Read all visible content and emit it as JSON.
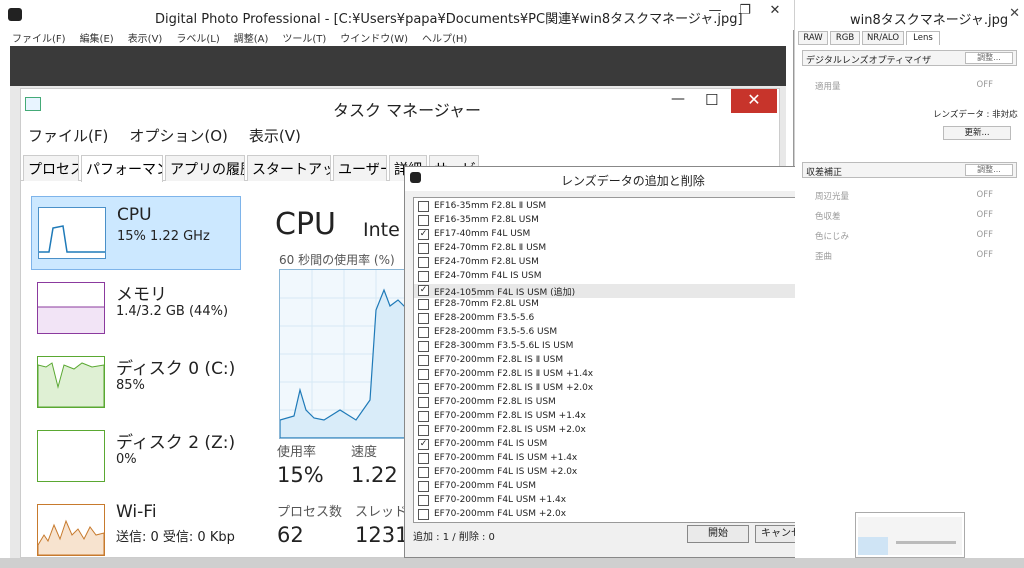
{
  "dpp": {
    "title": "Digital Photo Professional - [C:¥Users¥papa¥Documents¥PC関連¥win8タスクマネージャ.jpg]",
    "menu": [
      "ファイル(F)",
      "編集(E)",
      "表示(V)",
      "ラベル(L)",
      "調整(A)",
      "ツール(T)",
      "ウインドウ(W)",
      "ヘルプ(H)"
    ],
    "btn_min": "—",
    "btn_max": "❐",
    "btn_close": "✕"
  },
  "taskmgr": {
    "title": "タスク マネージャー",
    "btn_min": "—",
    "btn_max": "☐",
    "btn_close": "✕",
    "menu": [
      "ファイル(F)",
      "オプション(O)",
      "表示(V)"
    ],
    "tabs": [
      "プロセス",
      "パフォーマンス",
      "アプリの履歴",
      "スタートアップ",
      "ユーザー",
      "詳細",
      "サービス"
    ],
    "sidebar": [
      {
        "name": "CPU",
        "value": "15% 1.22 GHz"
      },
      {
        "name": "メモリ",
        "value": "1.4/3.2 GB (44%)"
      },
      {
        "name": "ディスク 0 (C:)",
        "value": "85%"
      },
      {
        "name": "ディスク 2 (Z:)",
        "value": "0%"
      },
      {
        "name": "Wi-Fi",
        "value": "送信: 0 受信: 0 Kbp"
      }
    ],
    "cpu": {
      "heading": "CPU",
      "model": "Inte",
      "graph_label": "60 秒間の使用率 (%)",
      "usage_label": "使用率",
      "usage": "15%",
      "speed_label": "速度",
      "speed": "1.22",
      "proc_label": "プロセス数",
      "proc": "62",
      "thread_label": "スレッド数",
      "thread": "1231"
    }
  },
  "lensdlg": {
    "title": "レンズデータの追加と削除",
    "btn_close": "✕",
    "lenses": [
      {
        "label": "EF16-35mm F2.8L Ⅱ USM",
        "checked": false
      },
      {
        "label": "EF16-35mm F2.8L USM",
        "checked": false
      },
      {
        "label": "EF17-40mm F4L USM",
        "checked": true
      },
      {
        "label": "EF24-70mm F2.8L Ⅱ USM",
        "checked": false
      },
      {
        "label": "EF24-70mm F2.8L USM",
        "checked": false
      },
      {
        "label": "EF24-70mm F4L IS USM",
        "checked": false
      },
      {
        "label": "EF24-105mm F4L IS USM (追加)",
        "checked": true
      },
      {
        "label": "EF28-70mm F2.8L USM",
        "checked": false
      },
      {
        "label": "EF28-200mm F3.5-5.6",
        "checked": false
      },
      {
        "label": "EF28-200mm F3.5-5.6 USM",
        "checked": false
      },
      {
        "label": "EF28-300mm F3.5-5.6L IS USM",
        "checked": false
      },
      {
        "label": "EF70-200mm F2.8L IS Ⅱ USM",
        "checked": false
      },
      {
        "label": "EF70-200mm F2.8L IS Ⅱ USM +1.4x",
        "checked": false
      },
      {
        "label": "EF70-200mm F2.8L IS Ⅱ USM +2.0x",
        "checked": false
      },
      {
        "label": "EF70-200mm F2.8L IS USM",
        "checked": false
      },
      {
        "label": "EF70-200mm F2.8L IS USM +1.4x",
        "checked": false
      },
      {
        "label": "EF70-200mm F2.8L IS USM +2.0x",
        "checked": false
      },
      {
        "label": "EF70-200mm F4L IS USM",
        "checked": true
      },
      {
        "label": "EF70-200mm F4L IS USM +1.4x",
        "checked": false
      },
      {
        "label": "EF70-200mm F4L IS USM +2.0x",
        "checked": false
      },
      {
        "label": "EF70-200mm F4L USM",
        "checked": false
      },
      {
        "label": "EF70-200mm F4L USM +1.4x",
        "checked": false
      },
      {
        "label": "EF70-200mm F4L USM +2.0x",
        "checked": false
      }
    ],
    "status": "追加 : 1 / 削除 : 0",
    "ok": "開始",
    "cancel": "キャンセル"
  },
  "rightpanel": {
    "title": "win8タスクマネージャ.jpg",
    "btn_close": "✕",
    "tabs": [
      "RAW",
      "RGB",
      "NR/ALO",
      "Lens"
    ],
    "sec1": {
      "label": "デジタルレンズオプティマイザ",
      "button": "調整..."
    },
    "apply_label": "適用量",
    "apply_value": "OFF",
    "lensdata": "レンズデータ : 非対応",
    "update_button": "更新...",
    "sec2": {
      "label": "収差補正",
      "button": "調整..."
    },
    "rows": [
      {
        "label": "周辺光量",
        "value": "OFF"
      },
      {
        "label": "色収差",
        "value": "OFF"
      },
      {
        "label": "色にじみ",
        "value": "OFF"
      },
      {
        "label": "歪曲",
        "value": "OFF"
      }
    ]
  }
}
